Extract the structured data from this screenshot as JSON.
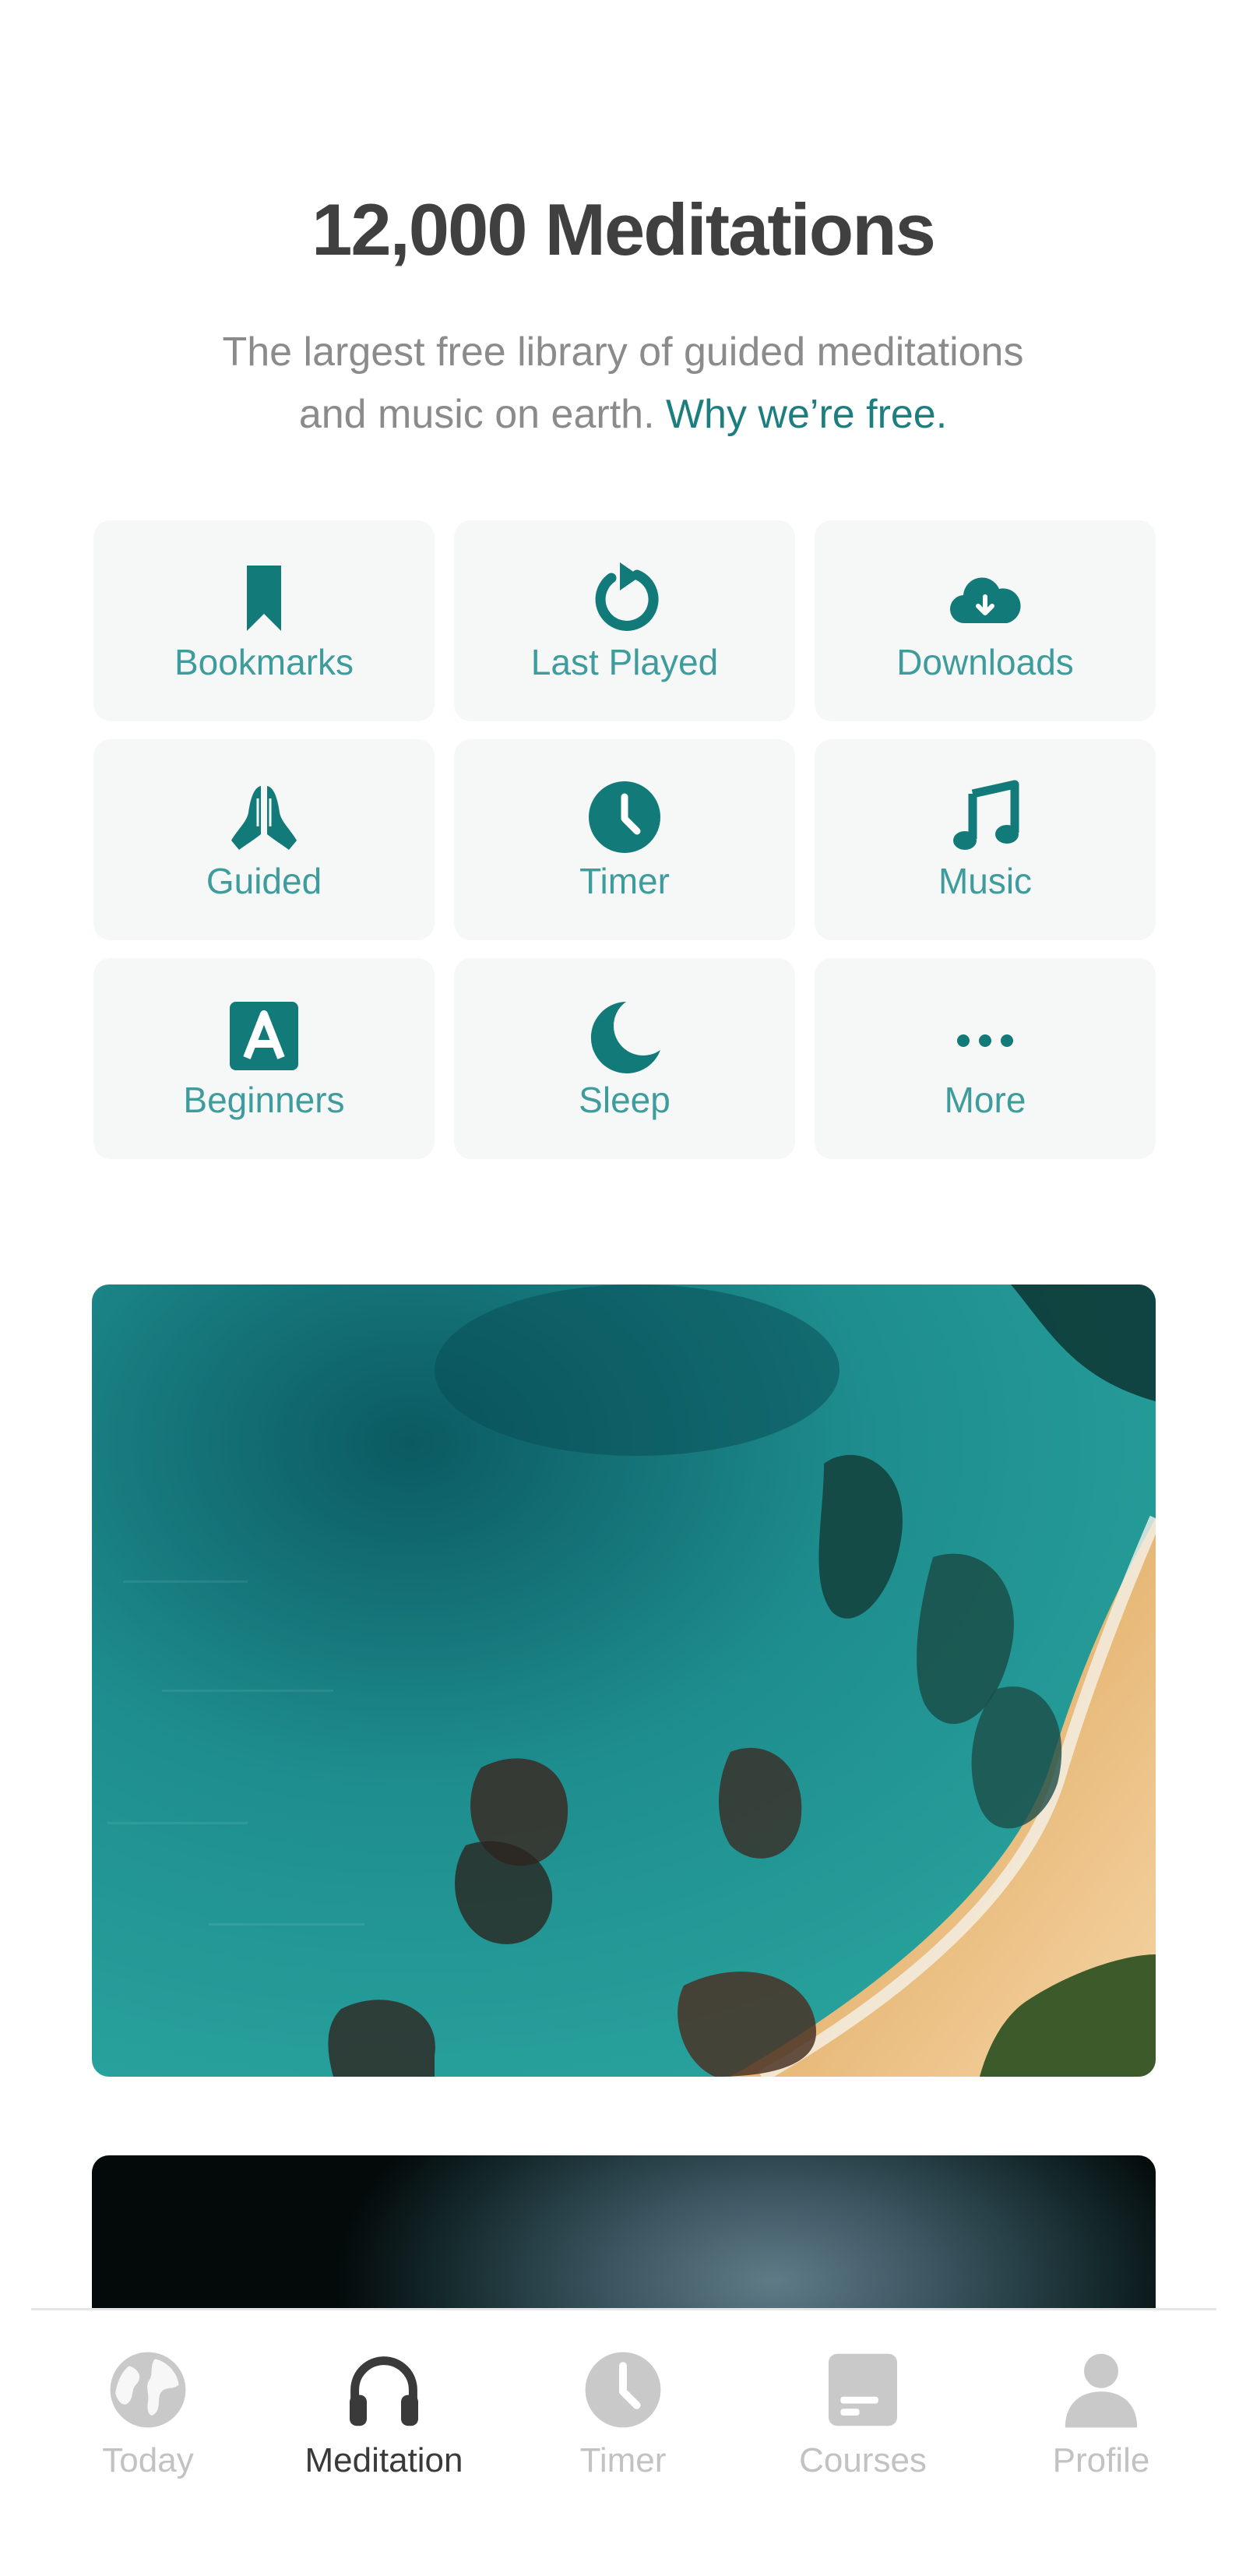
{
  "header": {
    "title": "12,000 Meditations",
    "subtitle_line1": "The largest free library of guided meditations",
    "subtitle_line2": "and music on earth.",
    "subtitle_link": "Why we’re free."
  },
  "categories": [
    {
      "label": "Bookmarks",
      "icon": "bookmark-icon"
    },
    {
      "label": "Last Played",
      "icon": "history-icon"
    },
    {
      "label": "Downloads",
      "icon": "cloud-download-icon"
    },
    {
      "label": "Guided",
      "icon": "praying-hands-icon"
    },
    {
      "label": "Timer",
      "icon": "clock-icon"
    },
    {
      "label": "Music",
      "icon": "music-note-icon"
    },
    {
      "label": "Beginners",
      "icon": "letter-a-icon"
    },
    {
      "label": "Sleep",
      "icon": "moon-icon"
    },
    {
      "label": "More",
      "icon": "ellipsis-icon"
    }
  ],
  "tabs": [
    {
      "label": "Today",
      "icon": "globe-icon",
      "active": false
    },
    {
      "label": "Meditation",
      "icon": "headphones-icon",
      "active": true
    },
    {
      "label": "Timer",
      "icon": "clock-icon",
      "active": false
    },
    {
      "label": "Courses",
      "icon": "card-icon",
      "active": false
    },
    {
      "label": "Profile",
      "icon": "person-icon",
      "active": false
    }
  ],
  "colors": {
    "accent": "#1d7e80",
    "tile_label": "#3f9c9c",
    "tile_icon": "#137a7a",
    "tile_bg": "#f6f8f8",
    "tab_inactive": "#c2c2c2",
    "tab_active": "#3a3a3a"
  }
}
